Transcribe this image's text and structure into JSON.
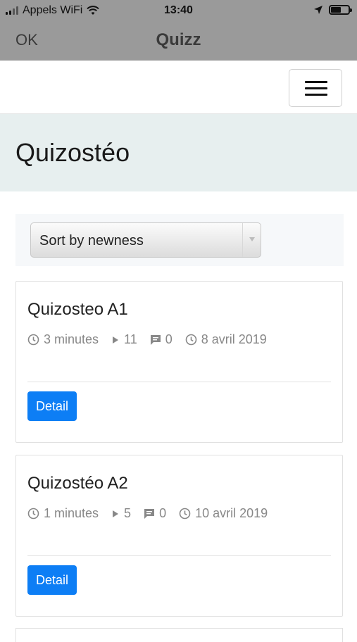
{
  "status_bar": {
    "carrier": "Appels WiFi",
    "time": "13:40",
    "icons": [
      "signal-icon",
      "wifi-icon",
      "location-arrow-icon",
      "battery-icon"
    ],
    "battery_level": 0.6
  },
  "nav": {
    "back_label": "OK",
    "title": "Quizz"
  },
  "header": {
    "menu_icon": "hamburger-menu-icon"
  },
  "hero": {
    "title": "Quizostéo"
  },
  "sort": {
    "selected": "Sort by newness"
  },
  "quizzes": [
    {
      "title": "Quizosteo A1",
      "duration": "3 minutes",
      "plays": "11",
      "comments": "0",
      "date": "8 avril 2019",
      "button_label": "Detail"
    },
    {
      "title": "Quizostéo A2",
      "duration": "1 minutes",
      "plays": "5",
      "comments": "0",
      "date": "10 avril 2019",
      "button_label": "Detail"
    }
  ],
  "colors": {
    "status_bar_bg": "#9a9a9a",
    "hero_bg": "#e7efef",
    "button_bg": "#0d7ef5",
    "meta_text": "#888888"
  }
}
